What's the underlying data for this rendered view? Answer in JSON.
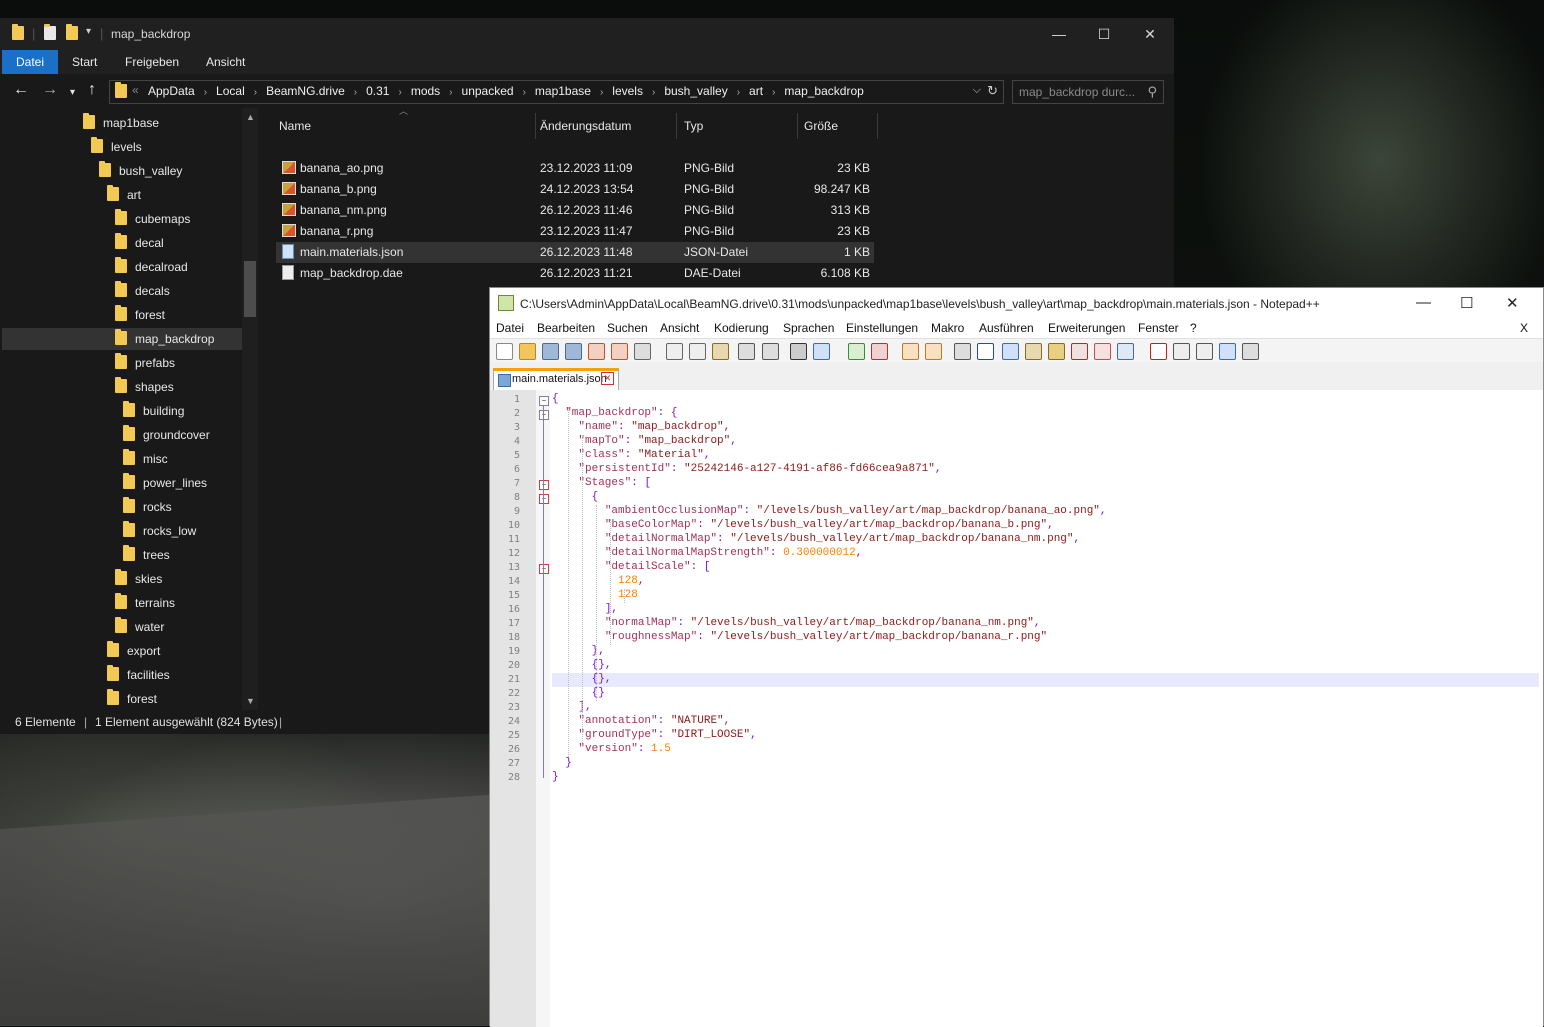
{
  "explorer": {
    "title": "map_backdrop",
    "ribbon_tabs": [
      "Datei",
      "Start",
      "Freigeben",
      "Ansicht"
    ],
    "breadcrumb_prefix": "«",
    "breadcrumbs": [
      "AppData",
      "Local",
      "BeamNG.drive",
      "0.31",
      "mods",
      "unpacked",
      "map1base",
      "levels",
      "bush_valley",
      "art",
      "map_backdrop"
    ],
    "search_placeholder": "map_backdrop durc...",
    "help_label": "?",
    "nav_items": [
      {
        "label": "map1base",
        "level": 0
      },
      {
        "label": "levels",
        "level": 1
      },
      {
        "label": "bush_valley",
        "level": 2
      },
      {
        "label": "art",
        "level": 3
      },
      {
        "label": "cubemaps",
        "level": 4
      },
      {
        "label": "decal",
        "level": 4
      },
      {
        "label": "decalroad",
        "level": 4
      },
      {
        "label": "decals",
        "level": 4
      },
      {
        "label": "forest",
        "level": 4
      },
      {
        "label": "map_backdrop",
        "level": 4,
        "selected": true
      },
      {
        "label": "prefabs",
        "level": 4
      },
      {
        "label": "shapes",
        "level": 4
      },
      {
        "label": "building",
        "level": 5
      },
      {
        "label": "groundcover",
        "level": 5
      },
      {
        "label": "misc",
        "level": 5
      },
      {
        "label": "power_lines",
        "level": 5
      },
      {
        "label": "rocks",
        "level": 5
      },
      {
        "label": "rocks_low",
        "level": 5
      },
      {
        "label": "trees",
        "level": 5
      },
      {
        "label": "skies",
        "level": 4
      },
      {
        "label": "terrains",
        "level": 4
      },
      {
        "label": "water",
        "level": 4
      },
      {
        "label": "export",
        "level": 3
      },
      {
        "label": "facilities",
        "level": 3
      },
      {
        "label": "forest",
        "level": 3
      }
    ],
    "columns": {
      "name": "Name",
      "date": "Änderungsdatum",
      "type": "Typ",
      "size": "Größe"
    },
    "files": [
      {
        "name": "banana_ao.png",
        "date": "23.12.2023 11:09",
        "type": "PNG-Bild",
        "size": "23 KB",
        "icon": "png-file-icon"
      },
      {
        "name": "banana_b.png",
        "date": "24.12.2023 13:54",
        "type": "PNG-Bild",
        "size": "98.247 KB",
        "icon": "png-file-icon"
      },
      {
        "name": "banana_nm.png",
        "date": "26.12.2023 11:46",
        "type": "PNG-Bild",
        "size": "313 KB",
        "icon": "png-file-icon"
      },
      {
        "name": "banana_r.png",
        "date": "23.12.2023 11:47",
        "type": "PNG-Bild",
        "size": "23 KB",
        "icon": "png-file-icon"
      },
      {
        "name": "main.materials.json",
        "date": "26.12.2023 11:48",
        "type": "JSON-Datei",
        "size": "1 KB",
        "icon": "json-file-icon",
        "selected": true
      },
      {
        "name": "map_backdrop.dae",
        "date": "26.12.2023 11:21",
        "type": "DAE-Datei",
        "size": "6.108 KB",
        "icon": "document-file-icon"
      }
    ],
    "status": {
      "count": "6 Elemente",
      "selection": "1 Element ausgewählt (824 Bytes)"
    },
    "accent_color": "#1a6fc7"
  },
  "notepad": {
    "title": "C:\\Users\\Admin\\AppData\\Local\\BeamNG.drive\\0.31\\mods\\unpacked\\map1base\\levels\\bush_valley\\art\\map_backdrop\\main.materials.json - Notepad++",
    "menu": [
      "Datei",
      "Bearbeiten",
      "Suchen",
      "Ansicht",
      "Kodierung",
      "Sprachen",
      "Einstellungen",
      "Makro",
      "Ausführen",
      "Erweiterungen",
      "Fenster",
      "?"
    ],
    "menu_close": "X",
    "tab_label": "main.materials.json",
    "highlighted_line": 21,
    "code_lines": [
      "{",
      "  \"map_backdrop\": {",
      "    \"name\": \"map_backdrop\",",
      "    \"mapTo\": \"map_backdrop\",",
      "    \"class\": \"Material\",",
      "    \"persistentId\": \"25242146-a127-4191-af86-fd66cea9a871\",",
      "    \"Stages\": [",
      "      {",
      "        \"ambientOcclusionMap\": \"/levels/bush_valley/art/map_backdrop/banana_ao.png\",",
      "        \"baseColorMap\": \"/levels/bush_valley/art/map_backdrop/banana_b.png\",",
      "        \"detailNormalMap\": \"/levels/bush_valley/art/map_backdrop/banana_nm.png\",",
      "        \"detailNormalMapStrength\": 0.300000012,",
      "        \"detailScale\": [",
      "          128,",
      "          128",
      "        ],",
      "        \"normalMap\": \"/levels/bush_valley/art/map_backdrop/banana_nm.png\",",
      "        \"roughnessMap\": \"/levels/bush_valley/art/map_backdrop/banana_r.png\"",
      "      },",
      "      {},",
      "      {},",
      "      {}",
      "    ],",
      "    \"annotation\": \"NATURE\",",
      "    \"groundType\": \"DIRT_LOOSE\",",
      "    \"version\": 1.5",
      "  }",
      "}"
    ]
  }
}
